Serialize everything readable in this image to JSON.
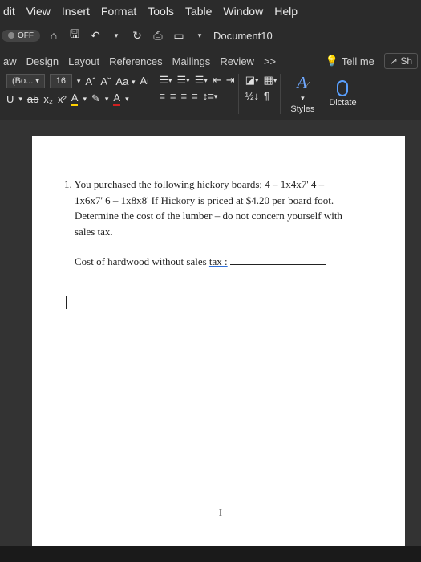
{
  "menubar": {
    "items": [
      "dit",
      "View",
      "Insert",
      "Format",
      "Tools",
      "Table",
      "Window",
      "Help"
    ]
  },
  "titlebar": {
    "off": "OFF",
    "doc_name": "Document10"
  },
  "tabs": {
    "items": [
      "aw",
      "Design",
      "Layout",
      "References",
      "Mailings",
      "Review"
    ],
    "more": ">>",
    "tellme": "Tell me",
    "share": "Sh"
  },
  "toolbar": {
    "font_name": "(Bo...",
    "font_size": "16",
    "grow": "Aˆ",
    "shrink": "Aˇ",
    "case": "Aa",
    "clear": "Aₗ",
    "underline": "U",
    "strike": "ab",
    "sub": "x₂",
    "sup": "x²",
    "hlA": "A",
    "pen": "✎",
    "fcA": "A",
    "sort": "½↓",
    "pilcrow": "¶",
    "styles_label": "Styles",
    "dictate_label": "Dictate"
  },
  "document": {
    "number": "1.",
    "line1a": "You purchased the following hickory ",
    "boards_word": "boards;",
    "line1b": "  4 – 1x4x7'   4 –",
    "line2": "1x6x7'   6 – 1x8x8'  If Hickory is priced at $4.20 per board foot.",
    "line3": "Determine the cost of the lumber – do not concern yourself with",
    "line4": "sales tax.",
    "prompt_a": "Cost of hardwood without sales ",
    "tax_word": "tax :",
    "footer_mark": "I"
  }
}
